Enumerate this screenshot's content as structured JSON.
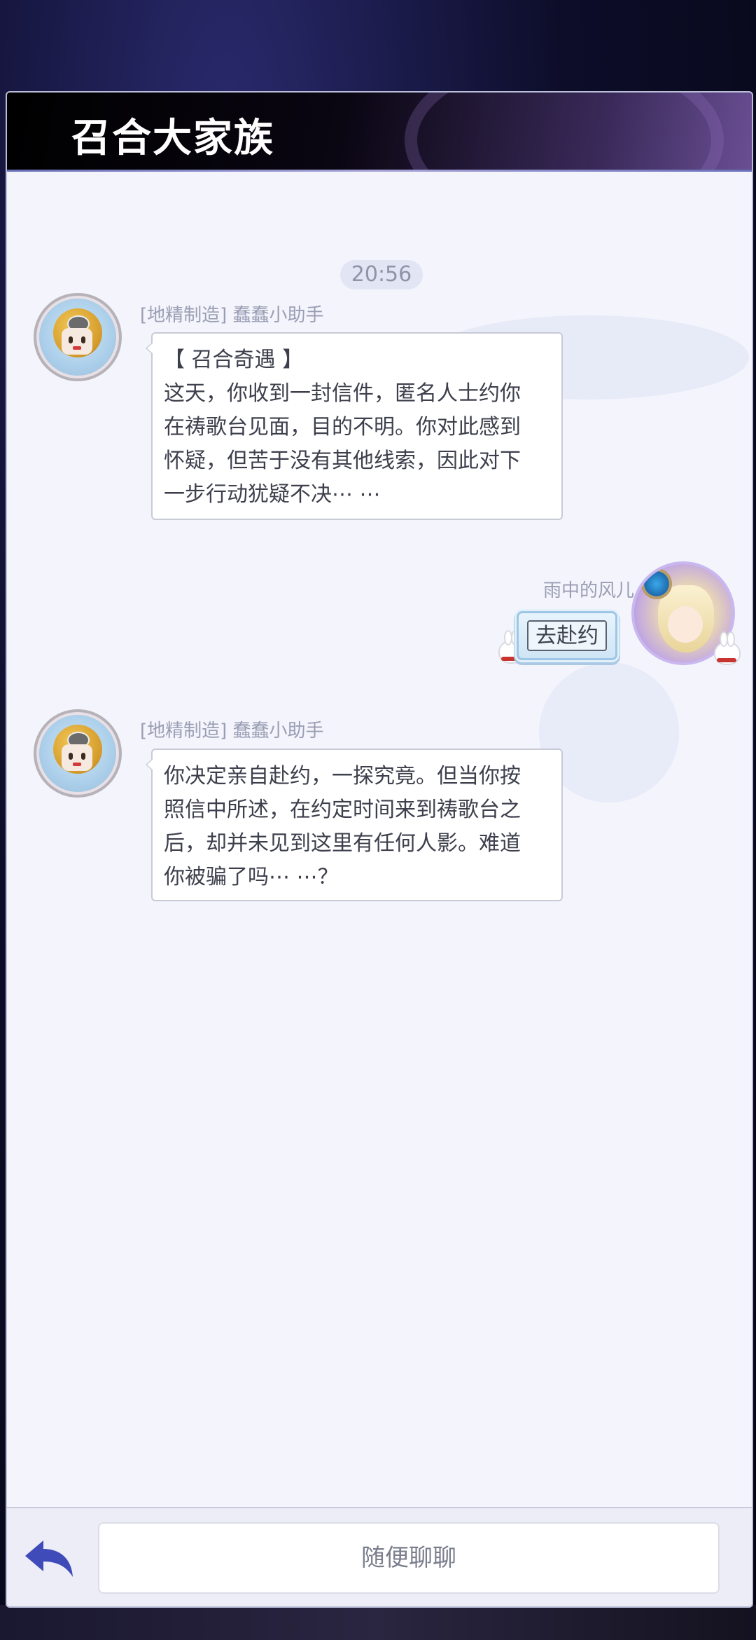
{
  "header": {
    "title": "召合大家族"
  },
  "chat": {
    "timestamp": "20:56",
    "messages": [
      {
        "sender": "[地精制造] 蠢蠢小助手",
        "avatar_icon": "goblin-robot-avatar",
        "lines": [
          "【 召合奇遇 】",
          "这天，你收到一封信件，匿名人士约你",
          "在祷歌台见面，目的不明。你对此感到",
          "怀疑，但苦于没有其他线索，因此对下",
          "一步行动犹疑不决⋯ ⋯"
        ]
      },
      {
        "sender": "雨中的风儿",
        "avatar_icon": "user-avatar",
        "text": "去赴约"
      },
      {
        "sender": "[地精制造] 蠢蠢小助手",
        "avatar_icon": "goblin-robot-avatar",
        "lines": [
          "你决定亲自赴约，一探究竟。但当你按",
          "照信中所述，在约定时间来到祷歌台之",
          "后，却并未见到这里有任何人影。难道",
          "你被骗了吗⋯ ⋯？"
        ]
      }
    ]
  },
  "footer": {
    "back_icon": "back-arrow-icon",
    "input_placeholder": "随便聊聊"
  },
  "colors": {
    "accent": "#3f4bb8",
    "panel_bg": "#f3f4fc",
    "bubble_border": "#c8cad6",
    "secondary_text": "#9a9eb3"
  }
}
